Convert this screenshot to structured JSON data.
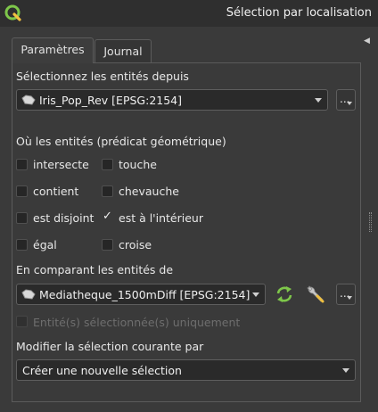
{
  "window": {
    "title": "Sélection par localisation"
  },
  "tabs": [
    {
      "label": "Paramètres",
      "active": true
    },
    {
      "label": "Journal",
      "active": false
    }
  ],
  "source": {
    "label": "Sélectionnez les entités depuis",
    "layer": "Iris_Pop_Rev [EPSG:2154]",
    "more_button": "..."
  },
  "predicate": {
    "label": "Où les entités (prédicat géométrique)",
    "options": [
      {
        "label": "intersecte",
        "checked": false
      },
      {
        "label": "touche",
        "checked": false
      },
      {
        "label": "contient",
        "checked": false
      },
      {
        "label": "chevauche",
        "checked": false
      },
      {
        "label": "est disjoint",
        "checked": false
      },
      {
        "label": "est à l'intérieur",
        "checked": true
      },
      {
        "label": "égal",
        "checked": false
      },
      {
        "label": "croise",
        "checked": false
      }
    ]
  },
  "compare": {
    "label": "En comparant les entités de",
    "layer": "Mediatheque_1500mDiff [EPSG:2154]",
    "more_button": "...",
    "selected_only_label": "Entité(s) sélectionnée(s) uniquement",
    "selected_only_checked": false
  },
  "modify": {
    "label": "Modifier la sélection courante par",
    "value": "Créer une nouvelle sélection"
  },
  "colors": {
    "background": "#3a3a3a",
    "field": "#2a2a2a",
    "accent_green": "#7ec74a"
  }
}
